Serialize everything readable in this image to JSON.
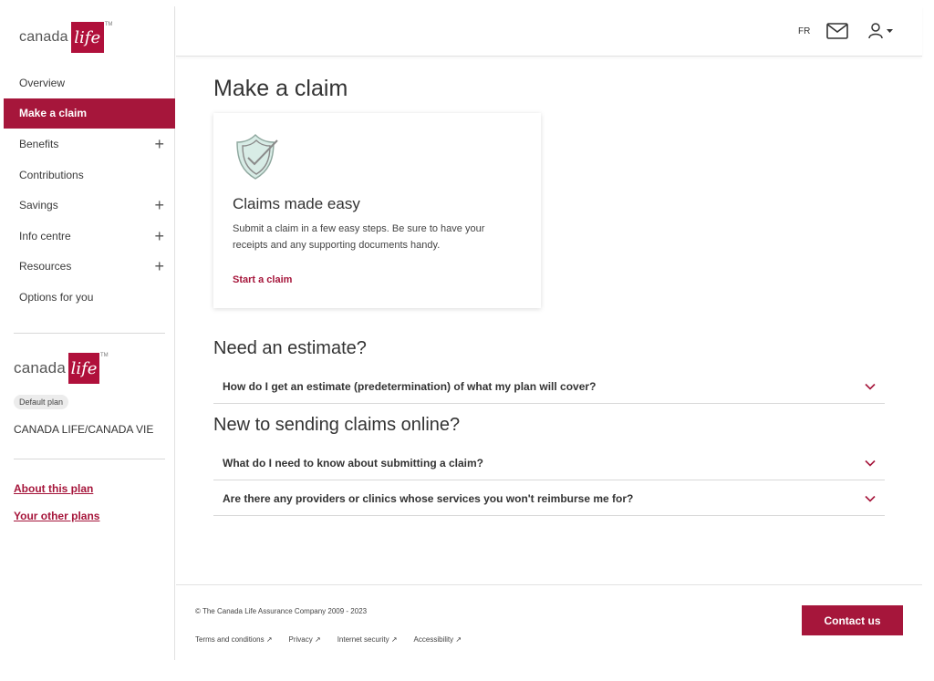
{
  "brand": {
    "word": "canada",
    "badge": "life",
    "tm": "TM",
    "accent": "#a6163b"
  },
  "sidebar": {
    "items": [
      {
        "label": "Overview",
        "expandable": false,
        "active": false
      },
      {
        "label": "Make a claim",
        "expandable": false,
        "active": true
      },
      {
        "label": "Benefits",
        "expandable": true,
        "active": false
      },
      {
        "label": "Contributions",
        "expandable": false,
        "active": false
      },
      {
        "label": "Savings",
        "expandable": true,
        "active": false
      },
      {
        "label": "Info centre",
        "expandable": true,
        "active": false
      },
      {
        "label": "Resources",
        "expandable": true,
        "active": false
      },
      {
        "label": "Options for you",
        "expandable": false,
        "active": false
      }
    ],
    "plan_badge": "Default plan",
    "plan_name": "CANADA LIFE/CANADA VIE",
    "links": {
      "about": "About this plan",
      "other": "Your other plans"
    }
  },
  "header": {
    "lang": "FR",
    "mail_icon": "envelope-icon",
    "user_icon": "user-icon"
  },
  "main": {
    "title": "Make a claim",
    "card": {
      "title": "Claims made easy",
      "text": "Submit a claim in a few easy steps. Be sure to have your receipts and any supporting documents handy.",
      "link": "Start a claim",
      "icon": "shield-check-icon"
    },
    "estimate": {
      "title": "Need an estimate?",
      "questions": [
        "How do I get an estimate (predetermination) of what my plan will cover?"
      ]
    },
    "online": {
      "title": "New to sending claims online?",
      "questions": [
        "What do I need to know about submitting a claim?",
        "Are there any providers or clinics whose services you won't reimburse me for?"
      ]
    }
  },
  "footer": {
    "copyright": "© The Canada Life Assurance Company 2009 - 2023",
    "links": [
      "Terms and conditions ↗",
      "Privacy ↗",
      "Internet security ↗",
      "Accessibility ↗"
    ],
    "contact": "Contact us"
  }
}
